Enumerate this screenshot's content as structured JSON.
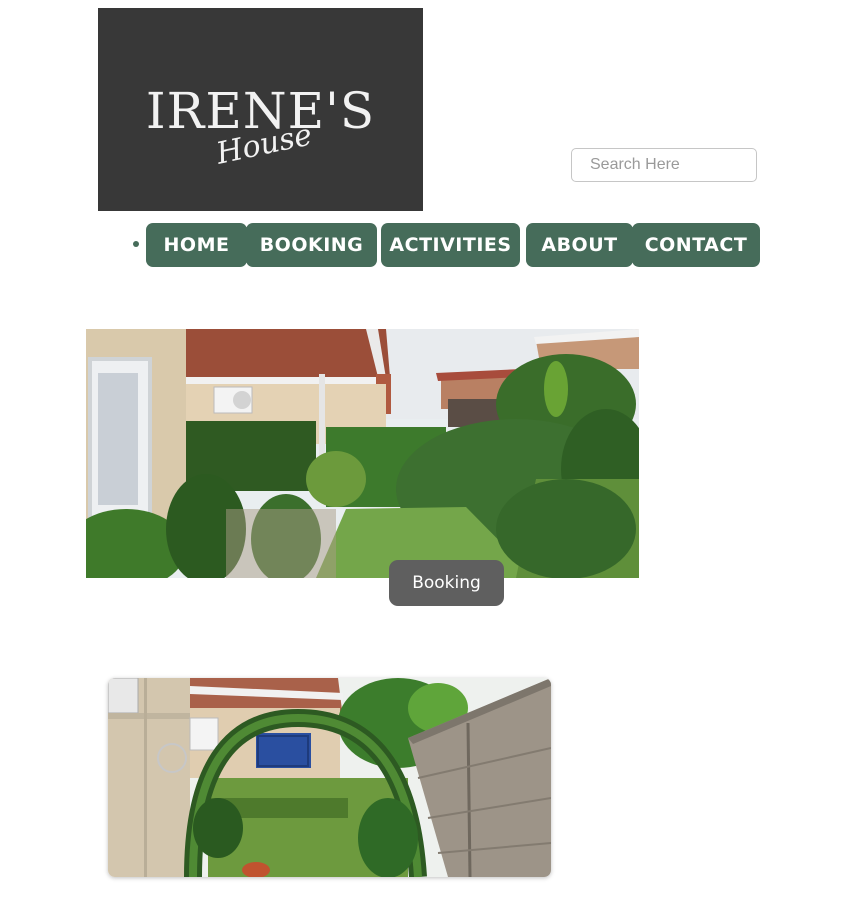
{
  "logo": {
    "title": "IRENE'S",
    "subtitle": "House"
  },
  "search": {
    "placeholder": "Search Here"
  },
  "nav": {
    "items": [
      {
        "label": "HOME"
      },
      {
        "label": "BOOKING"
      },
      {
        "label": "ACTIVITIES"
      },
      {
        "label": "ABOUT"
      },
      {
        "label": "CONTACT"
      }
    ]
  },
  "hero": {
    "button_label": "Booking"
  },
  "colors": {
    "nav_green": "#466c5a",
    "logo_bg": "#383838",
    "button_gray": "#5f5f5f"
  }
}
